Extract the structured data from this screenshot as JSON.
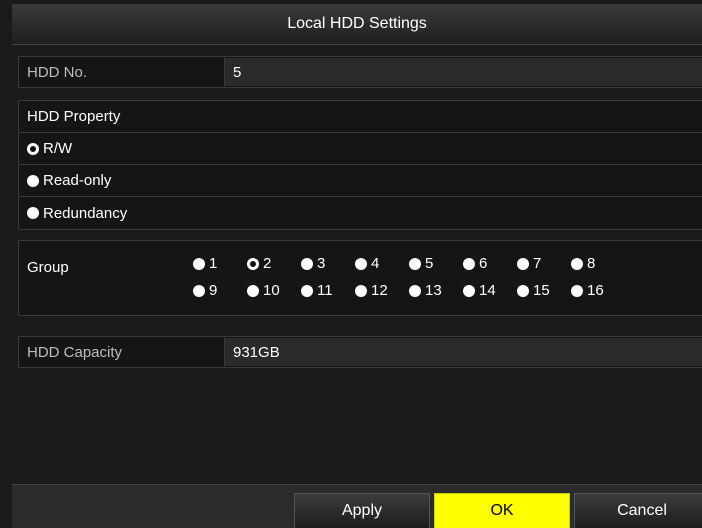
{
  "title": "Local HDD Settings",
  "hdd_no": {
    "label": "HDD No.",
    "value": "5"
  },
  "property": {
    "heading": "HDD Property",
    "options": [
      {
        "label": "R/W",
        "selected": true
      },
      {
        "label": "Read-only",
        "selected": false
      },
      {
        "label": "Redundancy",
        "selected": false
      }
    ]
  },
  "group": {
    "label": "Group",
    "options": [
      "1",
      "2",
      "3",
      "4",
      "5",
      "6",
      "7",
      "8",
      "9",
      "10",
      "11",
      "12",
      "13",
      "14",
      "15",
      "16"
    ],
    "selected": "2"
  },
  "capacity": {
    "label": "HDD Capacity",
    "value": "931GB"
  },
  "buttons": {
    "apply": "Apply",
    "ok": "OK",
    "cancel": "Cancel"
  },
  "colors": {
    "ok_button": "#ffff00",
    "background": "#1a1a1a"
  }
}
